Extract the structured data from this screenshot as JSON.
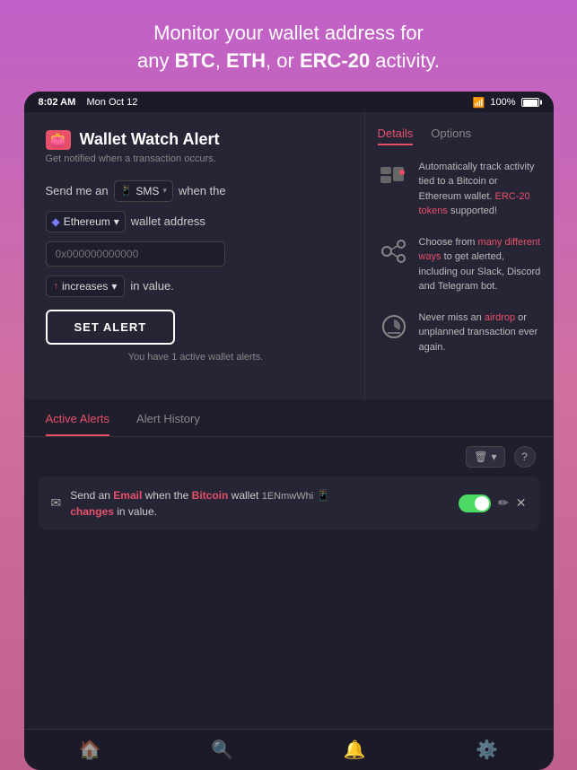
{
  "header": {
    "line1": "Monitor your wallet address for",
    "line2_prefix": "any ",
    "line2_bold1": "BTC",
    "line2_comma": ", ",
    "line2_bold2": "ETH",
    "line2_comma2": ", or ",
    "line2_bold3": "ERC-20",
    "line2_suffix": " activity."
  },
  "status_bar": {
    "time": "8:02 AM",
    "date": "Mon Oct 12",
    "signal": "📶",
    "battery_pct": "100%"
  },
  "left_panel": {
    "title": "Wallet Watch Alert",
    "subtitle": "Get notified when a transaction occurs.",
    "send_label": "Send me an",
    "sms_option": "SMS",
    "when_the": "when the",
    "eth_option": "Ethereum",
    "wallet_address": "wallet address",
    "address_placeholder": "0x000000000000",
    "increases_option": "increases",
    "in_value": "in value.",
    "set_alert_btn": "SET ALERT",
    "active_text": "You have 1 active wallet alerts."
  },
  "right_panel": {
    "tab_details": "Details",
    "tab_options": "Options",
    "feature1_text": "Automatically track activity tied to a Bitcoin or Ethereum wallet. ERC-20 tokens supported!",
    "feature1_link": "ERC-20 tokens",
    "feature2_text": "Choose from many different ways to get alerted, including our Slack, Discord and Telegram bot.",
    "feature2_link": "many different ways",
    "feature3_text": "Never miss an airdrop or unplanned transaction ever again.",
    "feature3_link": "airdrop"
  },
  "lower_panel": {
    "tab_active": "Active Alerts",
    "tab_history": "Alert History",
    "delete_icon": "🗑",
    "help_icon": "?",
    "alert_item": {
      "icon": "✉",
      "text_send": "Send an ",
      "text_email": "Email",
      "text_when": " when the ",
      "text_bitcoin": "Bitcoin",
      "text_wallet": " wallet ",
      "address": "1ENmwWhi",
      "text_changes": "changes",
      "text_in_value": " in value."
    }
  },
  "bottom_nav": {
    "items": [
      {
        "icon": "🏠",
        "label": "home"
      },
      {
        "icon": "🔍",
        "label": "search"
      },
      {
        "icon": "🔔",
        "label": "alerts"
      },
      {
        "icon": "⚙️",
        "label": "settings"
      }
    ]
  }
}
